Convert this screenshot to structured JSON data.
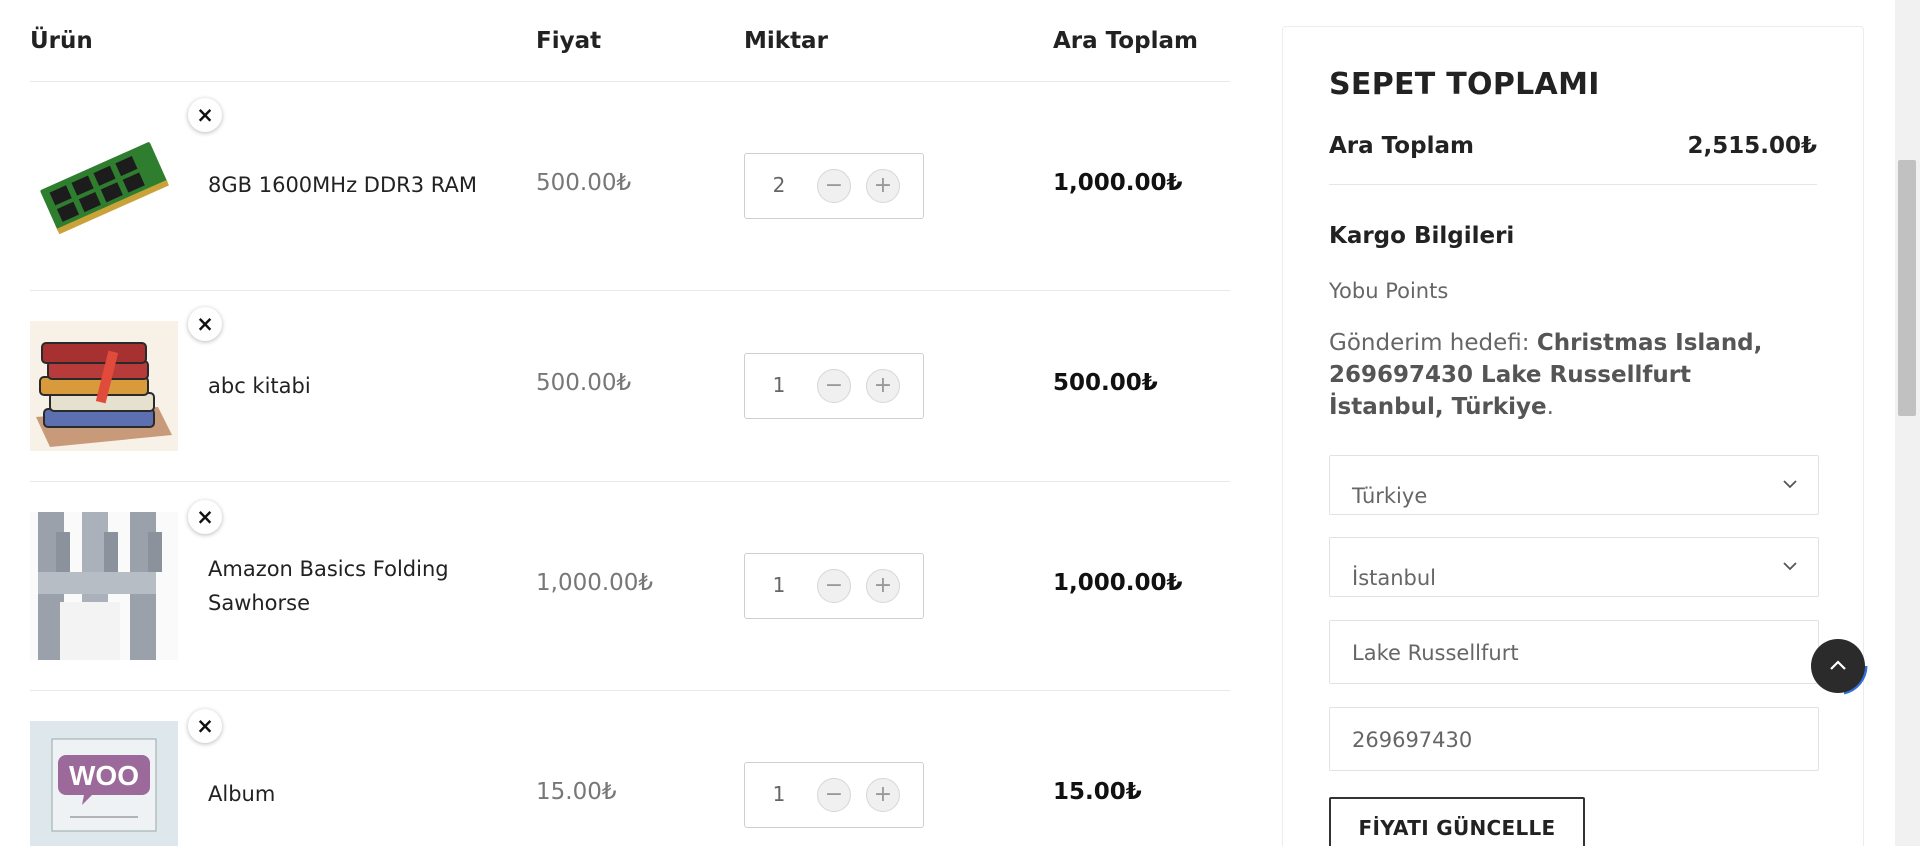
{
  "table": {
    "headers": {
      "product": "Ürün",
      "price": "Fiyat",
      "quantity": "Miktar",
      "subtotal": "Ara Toplam"
    },
    "items": [
      {
        "name": "8GB 1600MHz DDR3 RAM",
        "price": "500.00₺",
        "quantity": "2",
        "subtotal": "1,000.00₺",
        "image": "ram-module"
      },
      {
        "name": "abc kitabi",
        "price": "500.00₺",
        "quantity": "1",
        "subtotal": "500.00₺",
        "image": "book-stack"
      },
      {
        "name": "Amazon Basics Folding Sawhorse",
        "price": "1,000.00₺",
        "quantity": "1",
        "subtotal": "1,000.00₺",
        "image": "sawhorse"
      },
      {
        "name": "Album",
        "price": "15.00₺",
        "quantity": "1",
        "subtotal": "15.00₺",
        "image": "woo-album"
      }
    ],
    "remove_symbol": "×",
    "minus_symbol": "−",
    "plus_symbol": "+"
  },
  "totals": {
    "title": "SEPET TOPLAMI",
    "subtotal_label": "Ara Toplam",
    "subtotal_value": "2,515.00₺",
    "shipping_title": "Kargo Bilgileri",
    "shipping_method": "Yobu Points",
    "destination_prefix": "Gönderim hedefi: ",
    "destination_value": "Christmas Island, 269697430 Lake Russellfurt İstanbul, Türkiye",
    "destination_suffix": ".",
    "country": "Türkiye",
    "state": "İstanbul",
    "city": "Lake Russellfurt",
    "postcode": "269697430",
    "update_button": "FİYATI GÜNCELLE"
  },
  "colors": {
    "text": "#222222",
    "muted": "#777777",
    "border": "#e9e9e9",
    "scroll_button": "#2b2b2b",
    "progress_ring": "#2f6fd6"
  },
  "icons": [
    "close-icon",
    "minus-icon",
    "plus-icon",
    "chevron-down-icon",
    "chevron-up-icon"
  ]
}
